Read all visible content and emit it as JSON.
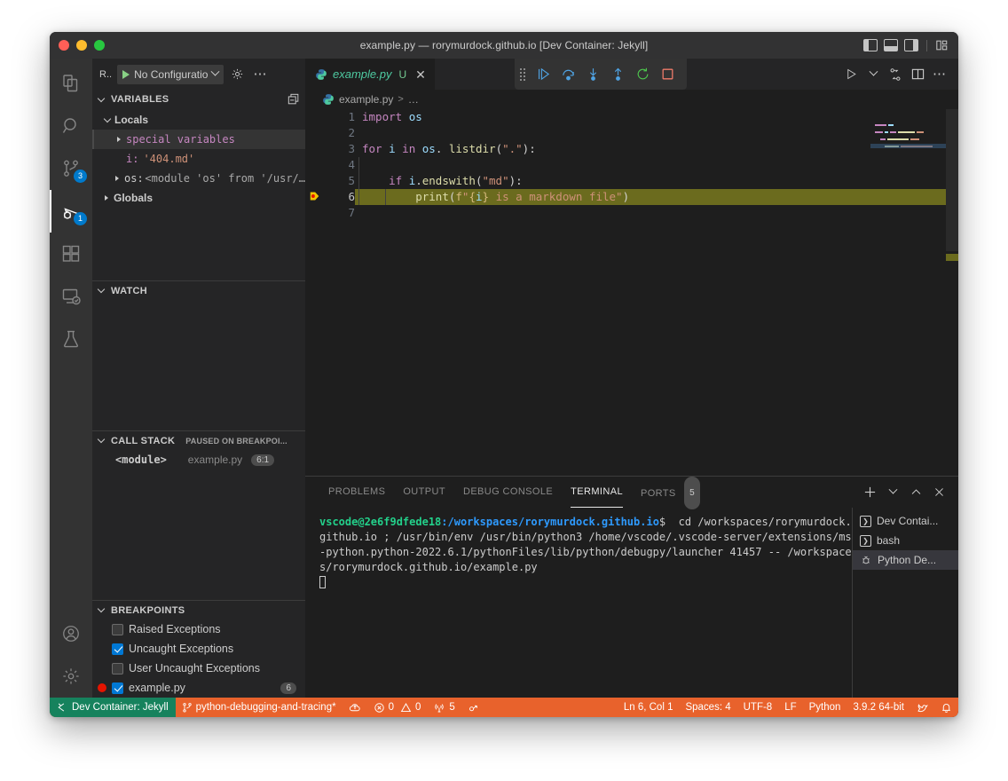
{
  "window": {
    "title": "example.py — rorymurdock.github.io [Dev Container: Jekyll]",
    "traffic": {
      "close": "close-window",
      "minimize": "minimize-window",
      "zoom": "zoom-window"
    },
    "layout_controls": [
      "toggle-primary-sidebar",
      "toggle-panel",
      "toggle-secondary-sidebar",
      "customize-layout"
    ]
  },
  "activitybar": {
    "items": [
      {
        "name": "explorer",
        "icon": "files-icon",
        "badge": ""
      },
      {
        "name": "search",
        "icon": "search-icon",
        "badge": ""
      },
      {
        "name": "source-control",
        "icon": "source-control-icon",
        "badge": "3"
      },
      {
        "name": "run-and-debug",
        "icon": "debug-icon",
        "badge": "1",
        "active": true
      },
      {
        "name": "extensions",
        "icon": "extensions-icon",
        "badge": ""
      },
      {
        "name": "remote-explorer",
        "icon": "remote-explorer-icon",
        "badge": ""
      },
      {
        "name": "testing",
        "icon": "beaker-icon",
        "badge": ""
      }
    ],
    "bottom": [
      {
        "name": "accounts",
        "icon": "account-icon"
      },
      {
        "name": "manage",
        "icon": "gear-icon"
      }
    ]
  },
  "sidebar": {
    "run_label": "R..",
    "configuration": "No Configuratio",
    "config_gear": "gear-icon",
    "config_more": "more-actions-icon",
    "sections": {
      "variables": {
        "title": "VARIABLES",
        "action_icon": "collapse-all-icon",
        "scopes": [
          {
            "name": "Locals",
            "expanded": true,
            "rows": [
              {
                "kind": "expandable",
                "name": "special variables",
                "value": "",
                "highlighted": true
              },
              {
                "kind": "leaf",
                "name": "i:",
                "value": "'404.md'"
              },
              {
                "kind": "expandable",
                "name": "os:",
                "value": "<module 'os' from '/usr/…"
              }
            ]
          },
          {
            "name": "Globals",
            "expanded": false,
            "rows": []
          }
        ]
      },
      "watch": {
        "title": "WATCH",
        "rows": []
      },
      "callstack": {
        "title": "CALL STACK",
        "subtitle": "PAUSED ON BREAKPOI...",
        "frames": [
          {
            "name": "<module>",
            "file": "example.py",
            "position": "6:1"
          }
        ]
      },
      "breakpoints": {
        "title": "BREAKPOINTS",
        "items": [
          {
            "label": "Raised Exceptions",
            "checked": false,
            "dot": false,
            "count": ""
          },
          {
            "label": "Uncaught Exceptions",
            "checked": true,
            "dot": false,
            "count": ""
          },
          {
            "label": "User Uncaught Exceptions",
            "checked": false,
            "dot": false,
            "count": ""
          },
          {
            "label": "example.py",
            "checked": true,
            "dot": true,
            "count": "6"
          }
        ]
      }
    }
  },
  "editor": {
    "tab": {
      "filename": "example.py",
      "dirty_badge": "U",
      "close": "close-tab-icon",
      "icon": "python-file-icon"
    },
    "tabbar_actions": [
      "run-python-file-icon",
      "run-options-chevron",
      "split-terminal-icon",
      "split-editor-icon",
      "more-actions-icon"
    ],
    "debug_toolbar": {
      "grip": "drag-handle",
      "buttons": [
        {
          "name": "continue",
          "icon": "continue-icon"
        },
        {
          "name": "step-over",
          "icon": "step-over-icon"
        },
        {
          "name": "step-into",
          "icon": "step-into-icon"
        },
        {
          "name": "step-out",
          "icon": "step-out-icon"
        },
        {
          "name": "restart",
          "icon": "restart-icon"
        },
        {
          "name": "stop",
          "icon": "stop-icon"
        }
      ]
    },
    "breadcrumbs": {
      "file": "example.py",
      "separator": ">",
      "trail": "…"
    },
    "lines": [
      {
        "no": "1",
        "tokens": [
          {
            "t": "import ",
            "c": "k"
          },
          {
            "t": "os",
            "c": "var"
          }
        ]
      },
      {
        "no": "2",
        "tokens": []
      },
      {
        "no": "3",
        "tokens": [
          {
            "t": "for ",
            "c": "k"
          },
          {
            "t": "i",
            "c": "var"
          },
          {
            "t": " in ",
            "c": "k"
          },
          {
            "t": "os",
            "c": "var"
          },
          {
            "t": ". ",
            "c": "pn"
          },
          {
            "t": "listdir",
            "c": "fn"
          },
          {
            "t": "(",
            "c": "pn"
          },
          {
            "t": "\".\"",
            "c": "str"
          },
          {
            "t": "):",
            "c": "pn"
          }
        ]
      },
      {
        "no": "4",
        "tokens": []
      },
      {
        "no": "5",
        "tokens": [
          {
            "t": "    ",
            "c": "pn"
          },
          {
            "t": "if ",
            "c": "k"
          },
          {
            "t": "i",
            "c": "var"
          },
          {
            "t": ".",
            "c": "pn"
          },
          {
            "t": "endswith",
            "c": "fn"
          },
          {
            "t": "(",
            "c": "pn"
          },
          {
            "t": "\"md\"",
            "c": "str"
          },
          {
            "t": "):",
            "c": "pn"
          }
        ]
      },
      {
        "no": "6",
        "current": true,
        "breakpoint": true,
        "tokens": [
          {
            "t": "        ",
            "c": "pn"
          },
          {
            "t": "print",
            "c": "fn"
          },
          {
            "t": "(",
            "c": "pn"
          },
          {
            "t": "f",
            "c": "fstr"
          },
          {
            "t": "\"",
            "c": "str"
          },
          {
            "t": "{",
            "c": "fstr"
          },
          {
            "t": "i",
            "c": "var"
          },
          {
            "t": "}",
            "c": "fstr"
          },
          {
            "t": " is a markdown file\"",
            "c": "str"
          },
          {
            "t": ")",
            "c": "pn"
          }
        ]
      },
      {
        "no": "7",
        "tokens": []
      }
    ]
  },
  "panel": {
    "tabs": [
      {
        "label": "PROBLEMS",
        "active": false,
        "badge": ""
      },
      {
        "label": "OUTPUT",
        "active": false,
        "badge": ""
      },
      {
        "label": "DEBUG CONSOLE",
        "active": false,
        "badge": ""
      },
      {
        "label": "TERMINAL",
        "active": true,
        "badge": ""
      },
      {
        "label": "PORTS",
        "active": false,
        "badge": "5"
      }
    ],
    "actions": [
      {
        "name": "new-terminal",
        "glyph": "+"
      },
      {
        "name": "terminal-options-chevron",
        "glyph": "⌄"
      },
      {
        "name": "maximize-panel",
        "glyph": "^"
      },
      {
        "name": "close-panel",
        "glyph": "✕"
      }
    ],
    "terminal": {
      "prompt_user": "vscode@2e6f9dfede18",
      "prompt_path": ":/workspaces/rorymurdock.github.io",
      "prompt_dollar": "$",
      "command": "  cd /workspaces/rorymurdock.github.io ; /usr/bin/env /usr/bin/python3 /home/vscode/.vscode-server/extensions/ms-python.python-2022.6.1/pythonFiles/lib/python/debugpy/launcher 41457 -- /workspaces/rorymurdock.github.io/example.py"
    },
    "terminal_list": [
      {
        "label": "Dev Contai...",
        "icon": "terminal-icon",
        "selected": false
      },
      {
        "label": "bash",
        "icon": "terminal-icon",
        "selected": false
      },
      {
        "label": "Python De...",
        "icon": "debug-bug-icon",
        "selected": true
      }
    ]
  },
  "statusbar": {
    "remote": {
      "label": "Dev Container: Jekyll",
      "icon": "remote-icon",
      "color": "#16825d"
    },
    "background": "#e8622c",
    "left": [
      {
        "name": "branch",
        "icon": "source-control-icon",
        "label": "python-debugging-and-tracing*"
      },
      {
        "name": "sync",
        "icon": "sync-cloud-icon",
        "label": ""
      },
      {
        "name": "problems",
        "icon": "error-warning-icon",
        "label": "0  0",
        "errors": "0",
        "warnings": "0"
      },
      {
        "name": "ports",
        "icon": "radio-tower-icon",
        "label": "5"
      },
      {
        "name": "debug-session",
        "icon": "debug-alt-icon",
        "label": ""
      }
    ],
    "right": [
      {
        "name": "line-col",
        "label": "Ln 6, Col 1"
      },
      {
        "name": "indentation",
        "label": "Spaces: 4"
      },
      {
        "name": "encoding",
        "label": "UTF-8"
      },
      {
        "name": "eol",
        "label": "LF"
      },
      {
        "name": "language-mode",
        "label": "Python"
      },
      {
        "name": "python-interpreter",
        "label": "3.9.2 64-bit"
      },
      {
        "name": "feedback",
        "icon": "tweet-icon",
        "label": ""
      },
      {
        "name": "notifications",
        "icon": "bell-icon",
        "label": ""
      }
    ]
  }
}
